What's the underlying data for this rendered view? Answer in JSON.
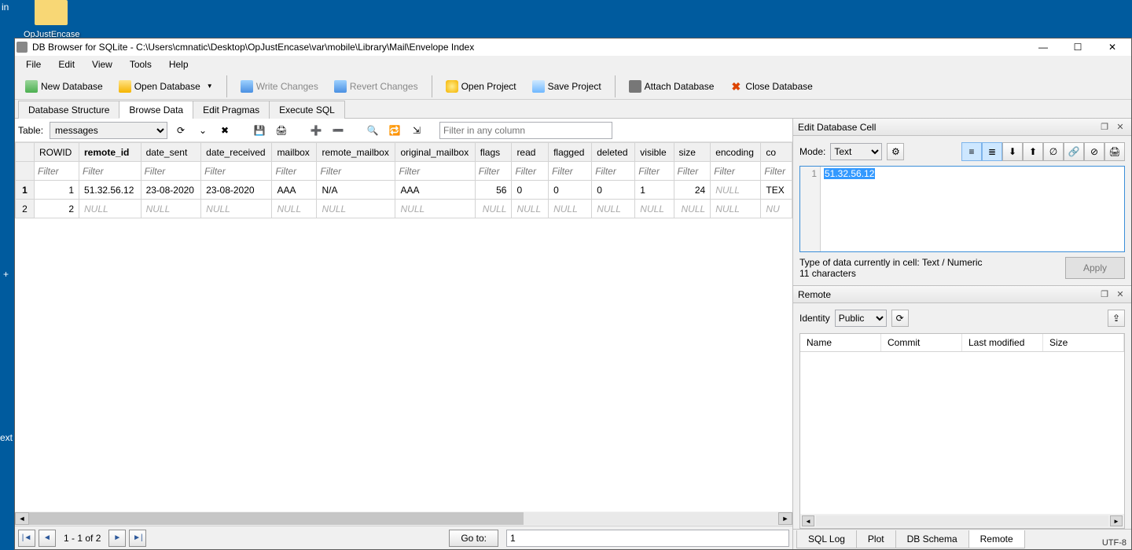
{
  "desktop": {
    "folder_name": "OpJustEncase",
    "left_in": "in",
    "left_plus": "+",
    "left_ext": "ext"
  },
  "window": {
    "title": "DB Browser for SQLite - C:\\Users\\cmnatic\\Desktop\\OpJustEncase\\var\\mobile\\Library\\Mail\\Envelope Index",
    "min": "—",
    "max": "☐",
    "close": "✕"
  },
  "menu": {
    "file": "File",
    "edit": "Edit",
    "view": "View",
    "tools": "Tools",
    "help": "Help"
  },
  "toolbar": {
    "new_db": "New Database",
    "open_db": "Open Database",
    "write": "Write Changes",
    "revert": "Revert Changes",
    "open_proj": "Open Project",
    "save_proj": "Save Project",
    "attach": "Attach Database",
    "close_db": "Close Database"
  },
  "tabs": {
    "structure": "Database Structure",
    "browse": "Browse Data",
    "pragmas": "Edit Pragmas",
    "sql": "Execute SQL"
  },
  "browse": {
    "table_label": "Table:",
    "table_value": "messages",
    "any_filter_placeholder": "Filter in any column",
    "columns": [
      "ROWID",
      "remote_id",
      "date_sent",
      "date_received",
      "mailbox",
      "remote_mailbox",
      "original_mailbox",
      "flags",
      "read",
      "flagged",
      "deleted",
      "visible",
      "size",
      "encoding",
      "co"
    ],
    "bold_col_index": 1,
    "filter_placeholder": "Filter",
    "rows": [
      {
        "rn": "1",
        "bold": true,
        "cells": [
          "1",
          "51.32.56.12",
          "23-08-2020",
          "23-08-2020",
          "AAA",
          "N/A",
          "AAA",
          "56",
          "0",
          "0",
          "0",
          "1",
          "24",
          "NULL",
          "TEX"
        ]
      },
      {
        "rn": "2",
        "bold": false,
        "cells": [
          "2",
          "NULL",
          "NULL",
          "NULL",
          "NULL",
          "NULL",
          "NULL",
          "NULL",
          "NULL",
          "NULL",
          "NULL",
          "NULL",
          "NULL",
          "NULL",
          "NU"
        ]
      }
    ],
    "null_token": "NULL",
    "right_align": [
      0,
      7,
      12
    ]
  },
  "pager": {
    "range": "1 - 1 of 2",
    "goto_label": "Go to:",
    "goto_value": "1"
  },
  "edit_cell": {
    "title": "Edit Database Cell",
    "mode_label": "Mode:",
    "mode_value": "Text",
    "line_no": "1",
    "value": "51.32.56.12",
    "type_text": "Type of data currently in cell: Text / Numeric",
    "char_text": "11 characters",
    "apply": "Apply"
  },
  "remote": {
    "title": "Remote",
    "identity_label": "Identity",
    "identity_value": "Public",
    "cols": [
      "Name",
      "Commit",
      "Last modified",
      "Size"
    ]
  },
  "bottom_tabs": {
    "sql_log": "SQL Log",
    "plot": "Plot",
    "schema": "DB Schema",
    "remote": "Remote"
  },
  "status": {
    "encoding": "UTF-8"
  }
}
